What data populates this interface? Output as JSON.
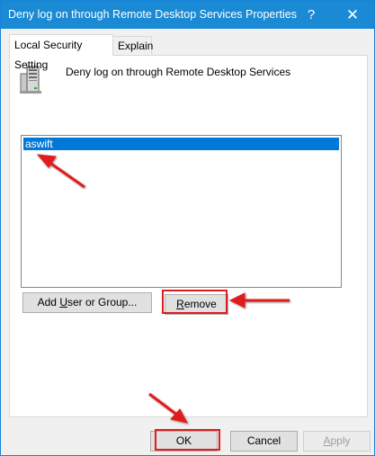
{
  "window": {
    "title": "Deny log on through Remote Desktop Services Properties",
    "help_glyph": "?",
    "close_glyph": "✕"
  },
  "tabs": [
    {
      "label": "Local Security Setting",
      "active": true
    },
    {
      "label": "Explain",
      "active": false
    }
  ],
  "policy": {
    "icon": "server-computer-icon",
    "title": "Deny log on through Remote Desktop Services"
  },
  "list": {
    "items": [
      {
        "label": "aswift",
        "selected": true
      }
    ]
  },
  "buttons": {
    "add_prefix": "Add ",
    "add_underline": "U",
    "add_suffix": "ser or Group...",
    "remove_underline": "R",
    "remove_suffix": "emove",
    "ok": "OK",
    "cancel": "Cancel",
    "apply_underline": "A",
    "apply_suffix": "pply"
  },
  "annotations": {
    "highlight_color": "#e11c1c",
    "arrow_icon": "red-arrow-icon"
  },
  "colors": {
    "titlebar": "#1a8ad4",
    "selection": "#0078d7"
  }
}
